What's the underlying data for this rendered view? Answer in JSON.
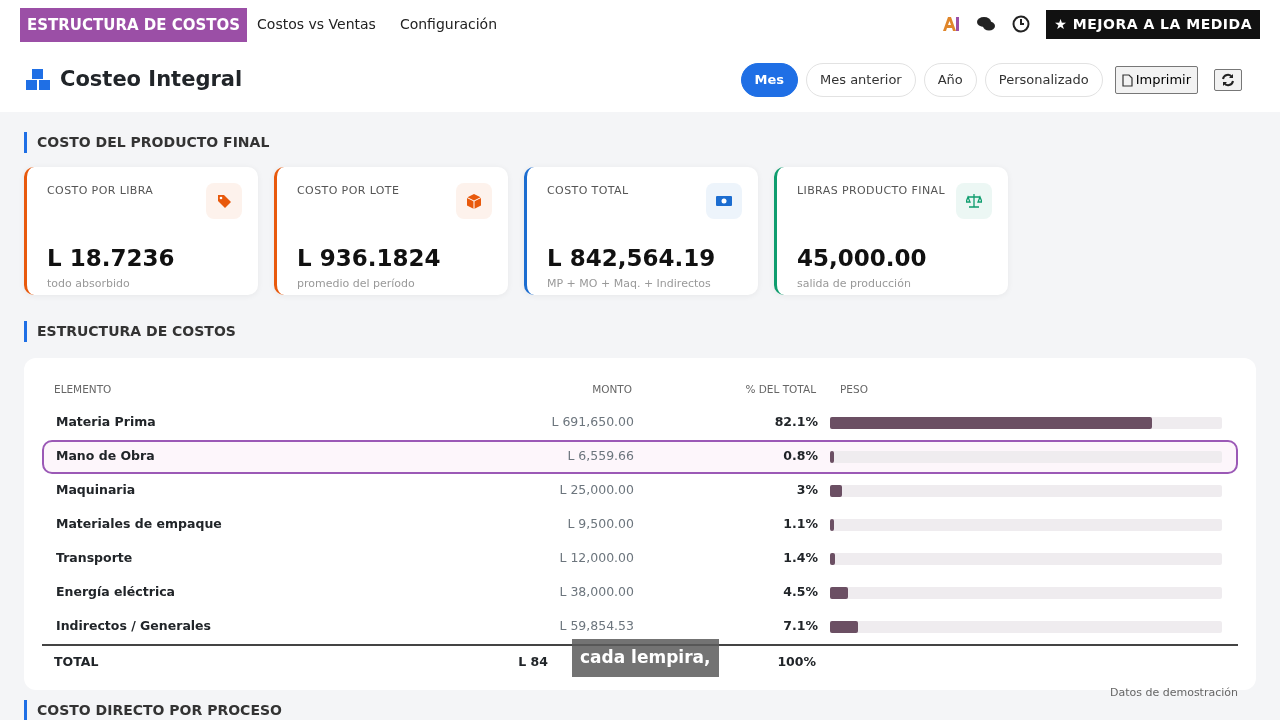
{
  "topbar": {
    "brand": "ESTRUCTURA DE COSTOS",
    "menu": [
      {
        "label": "Costos vs Ventas"
      },
      {
        "label": "Configuración"
      }
    ],
    "badge": "★ MEJORA A LA MEDIDA"
  },
  "header": {
    "title": "Costeo Integral",
    "periods": [
      {
        "label": "Mes",
        "selected": true
      },
      {
        "label": "Mes anterior",
        "selected": false
      },
      {
        "label": "Año",
        "selected": false
      },
      {
        "label": "Personalizado",
        "selected": false
      }
    ],
    "print": "Imprimir"
  },
  "sections": [
    {
      "title": "COSTO DEL PRODUCTO FINAL"
    },
    {
      "title": "ESTRUCTURA DE COSTOS"
    },
    {
      "title": "COSTO DIRECTO POR PROCESO"
    }
  ],
  "kpis": [
    {
      "label": "COSTO POR LIBRA",
      "value": "L 18.7236",
      "note": "todo absorbido",
      "color": "#e8590c",
      "kind": "tag"
    },
    {
      "label": "COSTO POR LOTE",
      "value": "L 936.1824",
      "note": "promedio del período",
      "color": "#e8590c",
      "kind": "box"
    },
    {
      "label": "COSTO TOTAL",
      "value": "L 842,564.19",
      "note": "MP + MO + Maq. + Indirectos",
      "color": "#1c6dd0",
      "kind": "money"
    },
    {
      "label": "LIBRAS PRODUCTO FINAL",
      "value": "45,000.00",
      "note": "salida de producción",
      "color": "#0f9d6e",
      "kind": "scale"
    }
  ],
  "table": {
    "columns": [
      "ELEMENTO",
      "MONTO",
      "% DEL TOTAL",
      "PESO"
    ],
    "rows": [
      {
        "element": "Materia Prima",
        "amount": "L 691,650.00",
        "percent": "82.1%",
        "level": 0.821,
        "selected": false
      },
      {
        "element": "Mano de Obra",
        "amount": "L 6,559.66",
        "percent": "0.8%",
        "level": 0.008,
        "selected": true
      },
      {
        "element": "Maquinaria",
        "amount": "L 25,000.00",
        "percent": "3%",
        "level": 0.03,
        "selected": false
      },
      {
        "element": "Materiales de empaque",
        "amount": "L 9,500.00",
        "percent": "1.1%",
        "level": 0.011,
        "selected": false
      },
      {
        "element": "Transporte",
        "amount": "L 12,000.00",
        "percent": "1.4%",
        "level": 0.014,
        "selected": false
      },
      {
        "element": "Energía eléctrica",
        "amount": "L 38,000.00",
        "percent": "4.5%",
        "level": 0.045,
        "selected": false
      },
      {
        "element": "Indirectos / Generales",
        "amount": "L 59,854.53",
        "percent": "7.1%",
        "level": 0.071,
        "selected": false
      }
    ],
    "total": {
      "label": "TOTAL",
      "amount": "L 84",
      "percent": "100%"
    }
  },
  "footnote": "Datos de demostración",
  "subtitle": "cada lempira,"
}
